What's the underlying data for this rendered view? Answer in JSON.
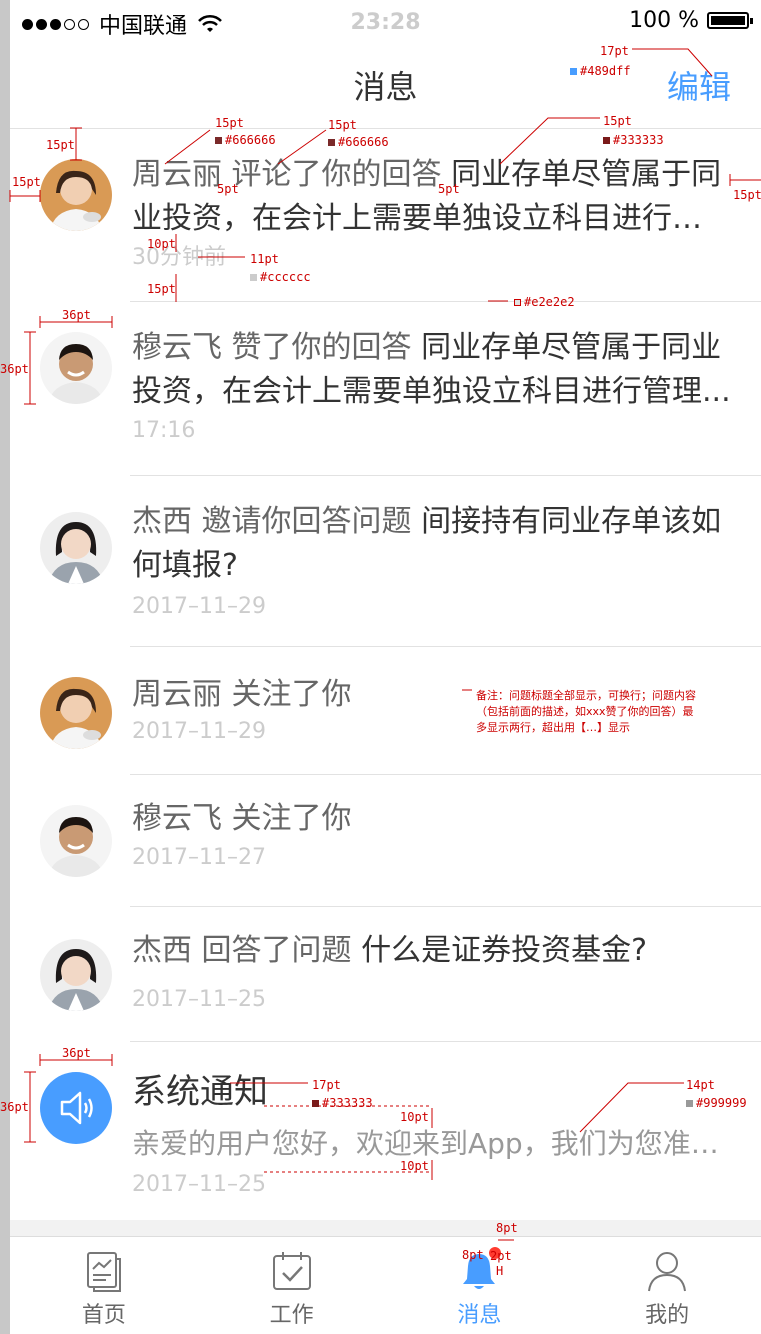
{
  "status": {
    "carrier": "中国联通",
    "time": "23:28",
    "battery": "100 %"
  },
  "nav": {
    "title": "消息",
    "edit": "编辑"
  },
  "items": [
    {
      "name": "周云丽",
      "action": "评论了你的回答",
      "content": "同业存单尽管属于同业投资，在会计上需要单独设立科目进行管理...",
      "time": "30分钟前"
    },
    {
      "name": "穆云飞",
      "action": "赞了你的回答",
      "content": "同业存单尽管属于同业投资，在会计上需要单独设立科目进行管理...",
      "time": "17:16"
    },
    {
      "name": "杰西",
      "action": "邀请你回答问题",
      "content": "间接持有同业存单该如何填报?",
      "time": "2017–11–29"
    },
    {
      "name": "周云丽",
      "action": "关注了你",
      "content": "",
      "time": "2017–11–29"
    },
    {
      "name": "穆云飞",
      "action": "关注了你",
      "content": "",
      "time": "2017–11–27"
    },
    {
      "name": "杰西",
      "action": "回答了问题",
      "content": "什么是证券投资基金?",
      "time": "2017–11–25"
    }
  ],
  "system": {
    "title": "系统通知",
    "desc": "亲爱的用户您好，欢迎来到App，我们为您准备...",
    "time": "2017–11–25"
  },
  "tabs": [
    {
      "label": "首页"
    },
    {
      "label": "工作"
    },
    {
      "label": "消息"
    },
    {
      "label": "我的"
    }
  ],
  "annotations": {
    "a1": "17pt",
    "a2": "#489dff",
    "a3": "15pt",
    "a4": "#666666",
    "a5": "15pt",
    "a6": "#666666",
    "a7": "15pt",
    "a8": "#333333",
    "a9": "15pt",
    "a10": "15pt",
    "a11": "5pt",
    "a12": "5pt",
    "a13": "15pt",
    "a14": "10pt",
    "a15": "11pt",
    "a16": "#cccccc",
    "a17": "15pt",
    "a18": "#e2e2e2",
    "a19": "36pt",
    "a20": "36pt",
    "a21": "36pt",
    "a22": "36pt",
    "a23": "17pt",
    "a24": "#333333",
    "a25": "10pt",
    "a26": "10pt",
    "a27": "14pt",
    "a28": "#999999",
    "a29": "8pt",
    "a30": "8pt",
    "a31": "2pt",
    "a32": "H",
    "note": "备注：问题标题全部显示，可换行；问题内容（包括前面的描述，如xxx赞了你的回答）最多显示两行，超出用【…】显示"
  },
  "colors": {
    "accent": "#489dff",
    "divider": "#e2e2e2",
    "text_main": "#333333",
    "text_sub": "#666666",
    "text_time": "#cccccc",
    "text_desc": "#999999"
  }
}
